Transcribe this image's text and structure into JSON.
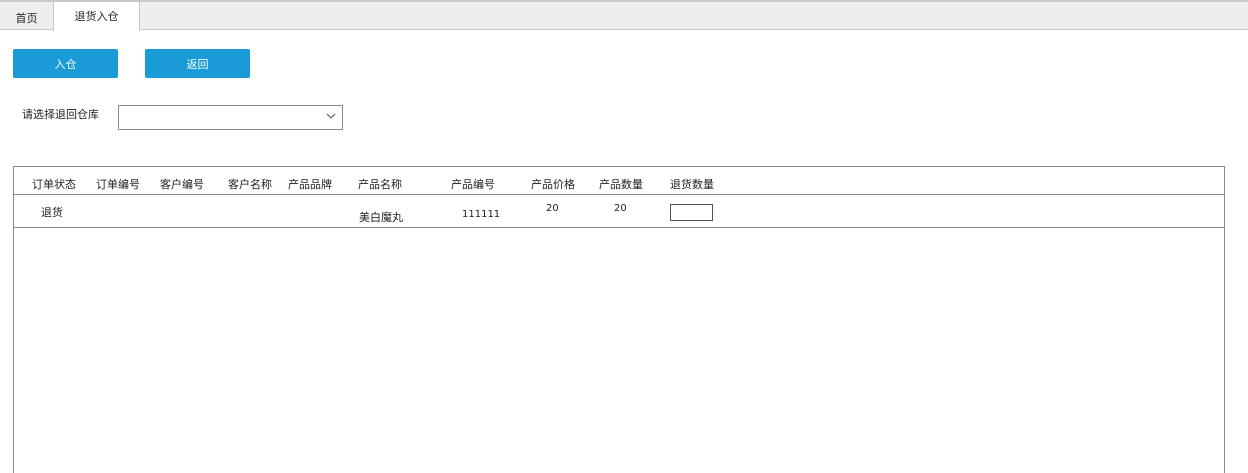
{
  "tabs": [
    {
      "label": "首页",
      "active": false
    },
    {
      "label": "退货入仓",
      "active": true
    }
  ],
  "toolbar": {
    "in_label": "入仓",
    "back_label": "返回",
    "button_color": "#1a9ad6"
  },
  "warehouse": {
    "label": "请选择退回仓库",
    "selected": ""
  },
  "table": {
    "columns": [
      "订单状态",
      "订单编号",
      "客户编号",
      "客户名称",
      "产品品牌",
      "产品名称",
      "产品编号",
      "产品价格",
      "产品数量",
      "退货数量"
    ],
    "rows": [
      {
        "status": "退货",
        "order_no": "",
        "customer_no": "",
        "customer_name": "",
        "brand": "",
        "product_name": "美白魔丸",
        "product_no": "111111",
        "price": "20",
        "quantity": "20",
        "return_qty": ""
      }
    ]
  }
}
